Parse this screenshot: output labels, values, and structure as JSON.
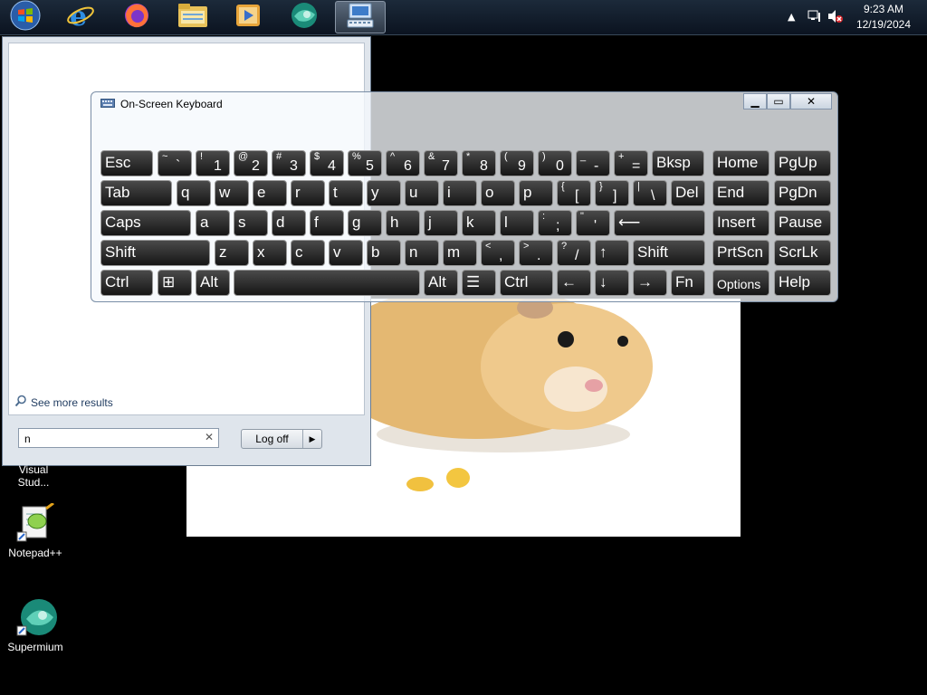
{
  "taskbar": {
    "time": "9:23 AM",
    "date": "12/19/2024",
    "items": [
      "start-orb",
      "internet-explorer",
      "firefox",
      "file-explorer",
      "media-player",
      "supermium",
      "on-screen-keyboard"
    ]
  },
  "start_menu": {
    "see_more": "See more results",
    "search_value": "n",
    "logoff_label": "Log off"
  },
  "desktop": {
    "icons": [
      {
        "label": "Visual Stud...",
        "icon": "visual-studio-icon"
      },
      {
        "label": "Notepad++",
        "icon": "notepad-plus-plus-icon"
      },
      {
        "label": "Supermium",
        "icon": "supermium-icon"
      }
    ]
  },
  "osk": {
    "title": "On-Screen Keyboard",
    "rows": [
      [
        {
          "main": "Esc"
        },
        {
          "shift": "~",
          "base": "`"
        },
        {
          "shift": "!",
          "base": "1"
        },
        {
          "shift": "@",
          "base": "2"
        },
        {
          "shift": "#",
          "base": "3"
        },
        {
          "shift": "$",
          "base": "4"
        },
        {
          "shift": "%",
          "base": "5"
        },
        {
          "shift": "^",
          "base": "6"
        },
        {
          "shift": "&",
          "base": "7"
        },
        {
          "shift": "*",
          "base": "8"
        },
        {
          "shift": "(",
          "base": "9"
        },
        {
          "shift": ")",
          "base": "0"
        },
        {
          "shift": "_",
          "base": "-"
        },
        {
          "shift": "+",
          "base": "="
        },
        {
          "main": "Bksp"
        },
        {
          "main": "Home"
        },
        {
          "main": "PgUp"
        }
      ],
      [
        {
          "main": "Tab"
        },
        {
          "main": "q"
        },
        {
          "main": "w"
        },
        {
          "main": "e"
        },
        {
          "main": "r"
        },
        {
          "main": "t"
        },
        {
          "main": "y"
        },
        {
          "main": "u"
        },
        {
          "main": "i"
        },
        {
          "main": "o"
        },
        {
          "main": "p"
        },
        {
          "shift": "{",
          "base": "["
        },
        {
          "shift": "}",
          "base": "]"
        },
        {
          "shift": "|",
          "base": "\\"
        },
        {
          "main": "Del"
        },
        {
          "main": "End"
        },
        {
          "main": "PgDn"
        }
      ],
      [
        {
          "main": "Caps"
        },
        {
          "main": "a"
        },
        {
          "main": "s"
        },
        {
          "main": "d"
        },
        {
          "main": "f"
        },
        {
          "main": "g"
        },
        {
          "main": "h"
        },
        {
          "main": "j"
        },
        {
          "main": "k"
        },
        {
          "main": "l"
        },
        {
          "shift": ":",
          "base": ";"
        },
        {
          "shift": "\"",
          "base": "'"
        },
        {
          "main": "⟵"
        },
        {
          "main": "Insert"
        },
        {
          "main": "Pause"
        }
      ],
      [
        {
          "main": "Shift"
        },
        {
          "main": "z"
        },
        {
          "main": "x"
        },
        {
          "main": "c"
        },
        {
          "main": "v"
        },
        {
          "main": "b"
        },
        {
          "main": "n"
        },
        {
          "main": "m"
        },
        {
          "shift": "<",
          "base": ","
        },
        {
          "shift": ">",
          "base": "."
        },
        {
          "shift": "?",
          "base": "/"
        },
        {
          "main": "↑"
        },
        {
          "main": "Shift"
        },
        {
          "main": "PrtScn"
        },
        {
          "main": "ScrLk"
        }
      ],
      [
        {
          "main": "Ctrl"
        },
        {
          "main": "⊞"
        },
        {
          "main": "Alt"
        },
        {
          "main": ""
        },
        {
          "main": "Alt"
        },
        {
          "main": "☰"
        },
        {
          "main": "Ctrl"
        },
        {
          "main": "←"
        },
        {
          "main": "↓"
        },
        {
          "main": "→"
        },
        {
          "main": "Fn"
        },
        {
          "main": "Options"
        },
        {
          "main": "Help"
        }
      ]
    ]
  }
}
